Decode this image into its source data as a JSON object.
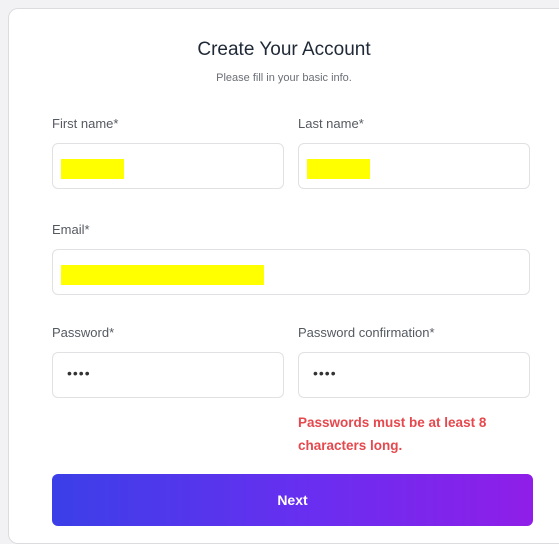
{
  "form": {
    "title": "Create Your Account",
    "subtitle": "Please fill in your basic info.",
    "first_name": {
      "label": "First name*",
      "redacted": true
    },
    "last_name": {
      "label": "Last name*",
      "redacted": true
    },
    "email": {
      "label": "Email*",
      "redacted": true
    },
    "password": {
      "label": "Password*",
      "masked_value": "••••"
    },
    "password_confirmation": {
      "label": "Password confirmation*",
      "masked_value": "••••"
    },
    "error_message": "Passwords must be at least 8 characters long.",
    "next_button": "Next"
  },
  "colors": {
    "error": "#e5484d",
    "button_gradient_start": "#3b3fe8",
    "button_gradient_end": "#8f1ee8",
    "redaction": "#ffff00"
  }
}
